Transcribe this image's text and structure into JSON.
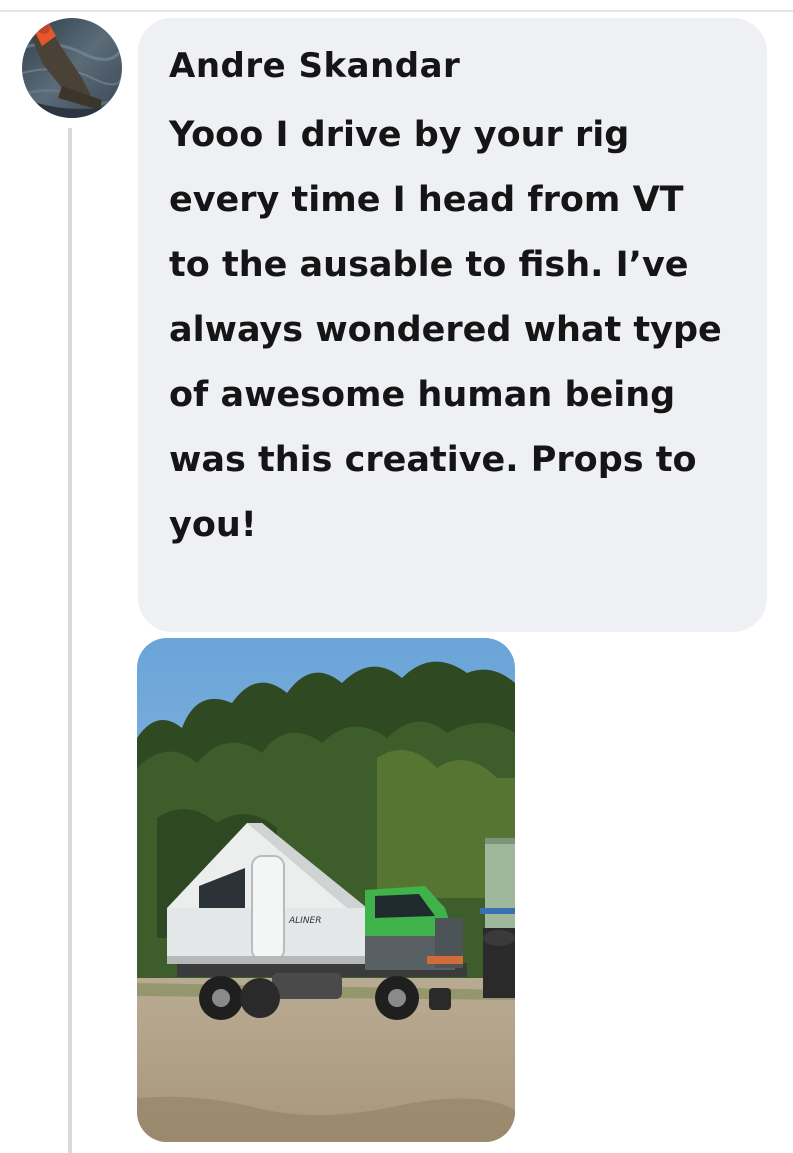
{
  "comment": {
    "author": "Andre Skandar",
    "text": "Yooo I drive by your rig every time I head from VT to the ausable to fish. I’ve always wondered what type of awesome human being was this creative. Props to you!"
  },
  "attachment": {
    "camper_decal": "ALINER"
  },
  "colors": {
    "bubble": "#eff0f4",
    "text": "#151515",
    "thread_line": "#d8dadf"
  }
}
